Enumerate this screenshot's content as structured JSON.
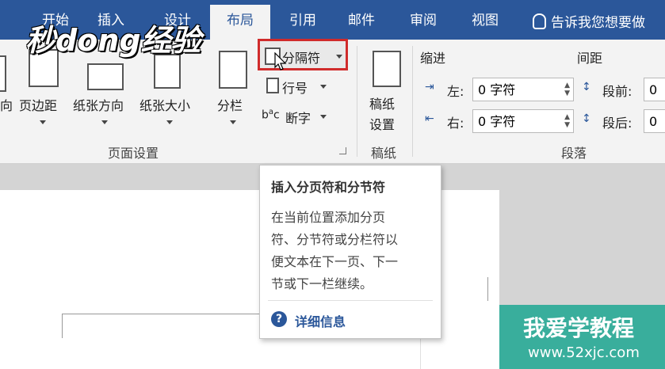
{
  "tabs": [
    {
      "label": "开始"
    },
    {
      "label": "插入"
    },
    {
      "label": "设计"
    },
    {
      "label": "布局"
    },
    {
      "label": "引用"
    },
    {
      "label": "邮件"
    },
    {
      "label": "审阅"
    },
    {
      "label": "视图"
    }
  ],
  "tell_me": "告诉我您想要做",
  "logo_text": "秒dong经验",
  "page_setup": {
    "direction_partial": "向",
    "margins": "页边距",
    "orientation": "纸张方向",
    "size": "纸张大小",
    "columns": "分栏",
    "breaks": "分隔符",
    "line_numbers": "行号",
    "hyphenation": "断字",
    "group_label": "页面设置"
  },
  "manuscript": {
    "settings_line1": "稿纸",
    "settings_line2": "设置",
    "group_label": "稿纸"
  },
  "paragraph": {
    "indent_label": "缩进",
    "spacing_label": "间距",
    "left_label": "左:",
    "right_label": "右:",
    "left_value": "0 字符",
    "right_value": "0 字符",
    "before_label": "段前:",
    "after_label": "段后:",
    "before_value": "0",
    "after_value": "0",
    "group_label": "段落"
  },
  "tooltip": {
    "title": "插入分页符和分节符",
    "lines": [
      "在当前位置添加分页",
      "符、分节符或分栏符以",
      "便文本在下一页、下一",
      "节或下一栏继续。"
    ],
    "help": "详细信息"
  },
  "watermark": {
    "line1": "我爱学教程",
    "line2": "www.52xjc.com"
  },
  "colors": {
    "accent": "#2b579a",
    "highlight_border": "#d02b2b"
  }
}
